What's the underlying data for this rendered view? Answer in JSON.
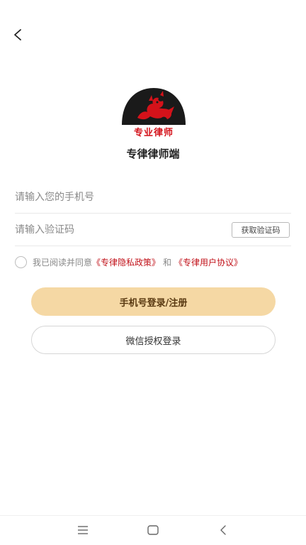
{
  "header": {
    "back_icon": "chevron-left-icon"
  },
  "logo": {
    "text": "专业律师",
    "accent": "#d4121a",
    "bg": "#1a1a1a"
  },
  "app": {
    "title": "专律律师端"
  },
  "form": {
    "phone_placeholder": "请输入您的手机号",
    "code_placeholder": "请输入验证码",
    "get_code_label": "获取验证码"
  },
  "agreement": {
    "prefix": "我已阅读并同意",
    "privacy_label": "《专律隐私政策》",
    "conjunction": "和",
    "user_agreement_label": "《专律用户协议》",
    "link_color": "#c1121a"
  },
  "buttons": {
    "login_label": "手机号登录/注册",
    "wechat_label": "微信授权登录",
    "primary_color": "#f5d8a4"
  },
  "system_nav": {
    "menu_icon": "menu-icon",
    "home_icon": "home-square-icon",
    "back_icon": "back-chevron-icon"
  }
}
